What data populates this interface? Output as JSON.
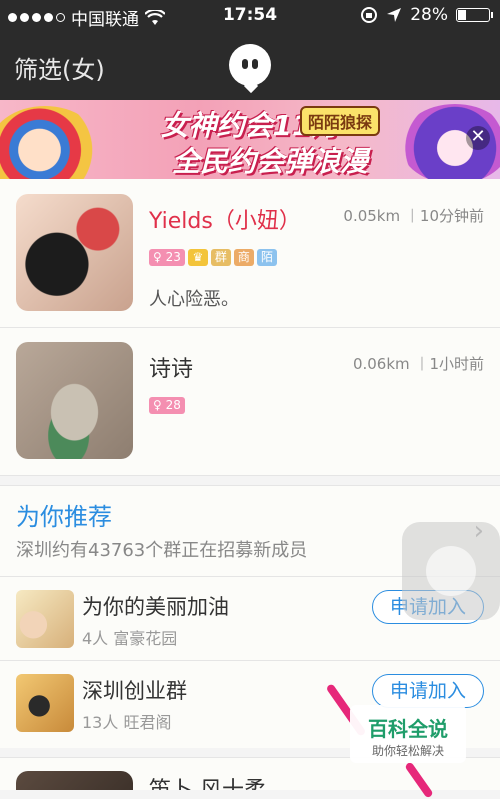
{
  "status_bar": {
    "carrier": "中国联通",
    "time": "17:54",
    "battery": "28%",
    "battery_level": 0.28
  },
  "navbar": {
    "title": "筛选(女)"
  },
  "banner": {
    "line1": "女神约会11月",
    "line2": "全民约会弹浪漫",
    "brand": "陌陌狼探"
  },
  "users": [
    {
      "name": "Yields（小妞）",
      "distance": "0.05km",
      "time": "10分钟前",
      "age": "23",
      "badges": [
        "群",
        "商",
        "陌"
      ],
      "signature": "人心险恶。"
    },
    {
      "name": "诗诗",
      "distance": "0.06km",
      "time": "1小时前",
      "age": "28"
    }
  ],
  "recommend": {
    "title": "为你推荐",
    "subtitle": "深圳约有43763个群正在招募新成员",
    "groups": [
      {
        "name": "为你的美丽加油",
        "members": "4人",
        "location": "富豪花园",
        "button": "申请加入"
      },
      {
        "name": "深圳创业群",
        "members": "13人",
        "location": "旺君阁",
        "button": "申请加入"
      }
    ]
  },
  "bottom_peek": {
    "name": "笛卜 风十柔"
  },
  "watermark": {
    "title": "百科全说",
    "subtitle": "助你轻松解决"
  },
  "colors": {
    "accent_blue": "#2b8de0",
    "name_red": "#e0304a",
    "topbar": "#2b2b2b"
  }
}
